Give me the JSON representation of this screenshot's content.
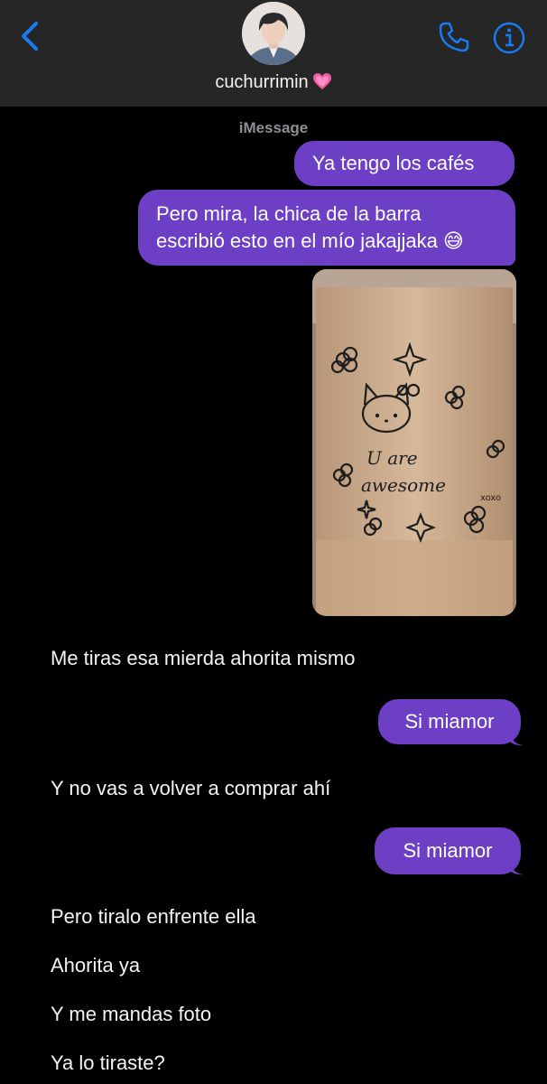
{
  "header": {
    "contact_name": "cuchurrimin",
    "back_icon": "chevron-left-icon",
    "phone_icon": "phone-icon",
    "info_icon": "info-icon",
    "accent_color": "#1a7cf5"
  },
  "thread": {
    "service_label": "iMessage",
    "bubble_color": "#6c3fc4",
    "messages": [
      {
        "from": "me",
        "text": "Ya tengo los cafés"
      },
      {
        "from": "me",
        "text_line1": "Pero mira, la chica de la barra",
        "text_line2": "escribió esto en el mío jakajjaka 😅"
      },
      {
        "from": "me",
        "type": "photo",
        "cup_text_1": "U are",
        "cup_text_2": "awesome",
        "cup_text_3": "xoxo"
      },
      {
        "from": "them",
        "text": "Me tiras esa mierda ahorita mismo"
      },
      {
        "from": "me",
        "text": "Si miamor"
      },
      {
        "from": "them",
        "text": "Y no vas a volver a comprar ahí"
      },
      {
        "from": "me",
        "text": "Si miamor"
      },
      {
        "from": "them",
        "text": "Pero tiralo enfrente ella"
      },
      {
        "from": "them",
        "text": "Ahorita ya"
      },
      {
        "from": "them",
        "text": "Y me mandas foto"
      },
      {
        "from": "them",
        "text": "Ya lo tiraste?"
      }
    ]
  }
}
